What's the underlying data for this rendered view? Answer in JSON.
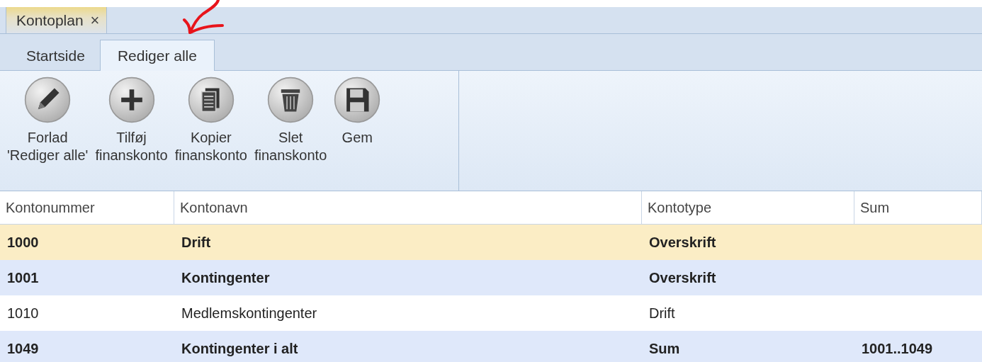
{
  "document_tabs": [
    {
      "label": "Kontoplan",
      "close": "×",
      "selected": true
    }
  ],
  "ribbon_tabs": [
    {
      "label": "Startside",
      "selected": false
    },
    {
      "label": "Rediger alle",
      "selected": true
    }
  ],
  "ribbon_buttons": [
    {
      "kind": "pencil",
      "label": "Forlad\n'Rediger alle'"
    },
    {
      "kind": "plus",
      "label": "Tilføj\nfinanskonto"
    },
    {
      "kind": "copy",
      "label": "Kopier\nfinanskonto"
    },
    {
      "kind": "trash",
      "label": "Slet\nfinanskonto"
    },
    {
      "kind": "save",
      "label": "Gem"
    }
  ],
  "table": {
    "columns": [
      "Kontonummer",
      "Kontonavn",
      "Kontotype",
      "Sum"
    ],
    "rows": [
      {
        "kind": "heading",
        "selected": true,
        "cells": [
          "1000",
          "Drift",
          "Overskrift",
          ""
        ]
      },
      {
        "kind": "heading",
        "selected": false,
        "cells": [
          "1001",
          "Kontingenter",
          "Overskrift",
          ""
        ]
      },
      {
        "kind": "account",
        "selected": false,
        "cells": [
          "1010",
          "Medlemskontingenter",
          "Drift",
          ""
        ]
      },
      {
        "kind": "total",
        "selected": false,
        "cells": [
          "1049",
          "Kontingenter i alt",
          "Sum",
          "1001..1049"
        ]
      }
    ]
  }
}
